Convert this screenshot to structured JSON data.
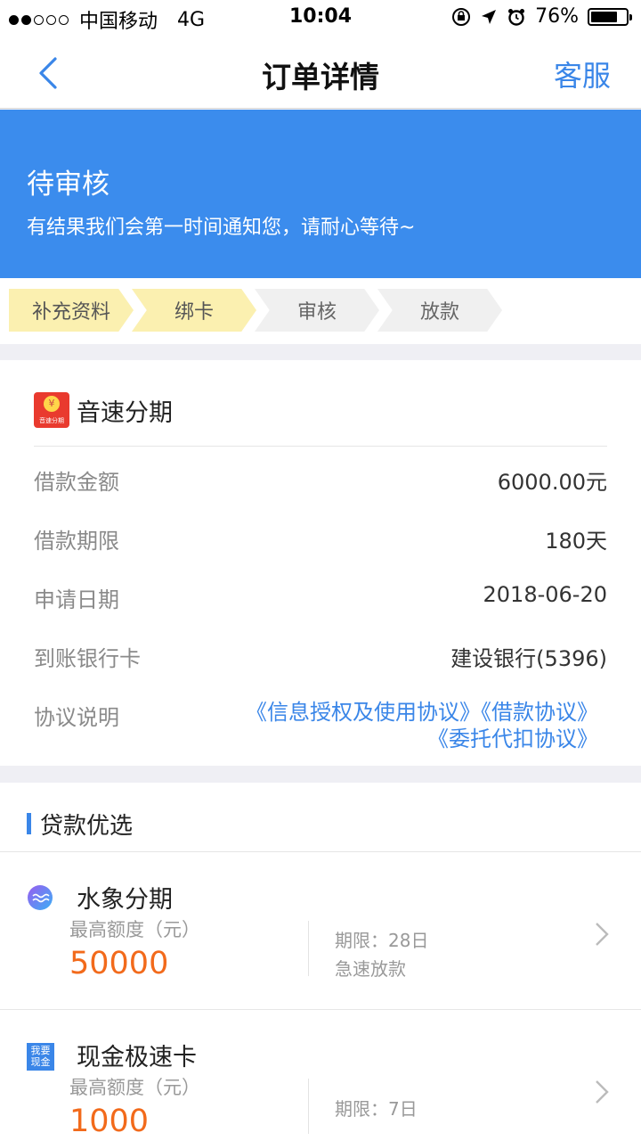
{
  "status_bar": {
    "carrier": "中国移动",
    "network": "4G",
    "time": "10:04",
    "battery_percent_label": "76%",
    "battery_level": 0.76,
    "signal_strength": 2,
    "signal_max": 5
  },
  "nav": {
    "title": "订单详情",
    "service_label": "客服",
    "accent_color": "#3a86e8"
  },
  "banner": {
    "title": "待审核",
    "subtitle": "有结果我们会第一时间通知您，请耐心等待~",
    "color": "#3b8ced"
  },
  "steps": [
    {
      "label": "补充资料",
      "done": true
    },
    {
      "label": "绑卡",
      "done": true
    },
    {
      "label": "审核",
      "done": false
    },
    {
      "label": "放款",
      "done": false
    }
  ],
  "order": {
    "product_name": "音速分期",
    "product_logo_text": "音速分期",
    "rows": [
      {
        "label": "借款金额",
        "value": "6000.00元"
      },
      {
        "label": "借款期限",
        "value": "180天"
      },
      {
        "label": "申请日期",
        "value": "2018-06-20"
      },
      {
        "label": "到账银行卡",
        "value": "建设银行(5396)"
      }
    ],
    "agreement_label": "协议说明",
    "agreements": [
      "《信息授权及使用协议》",
      "《借款协议》",
      "《委托代扣协议》"
    ]
  },
  "recommend": {
    "title": "贷款优选",
    "items": [
      {
        "name": "水象分期",
        "max_label": "最高额度（元）",
        "max_value": "50000",
        "term": "期限：28日",
        "feature": "急速放款",
        "icon": "water-circle-icon"
      },
      {
        "name": "现金极速卡",
        "max_label": "最高额度（元）",
        "max_value": "1000",
        "term": "期限：7日",
        "feature": "",
        "icon": "cash-square-icon",
        "icon_text": "我要现金"
      }
    ],
    "value_color": "#f26a1b"
  }
}
